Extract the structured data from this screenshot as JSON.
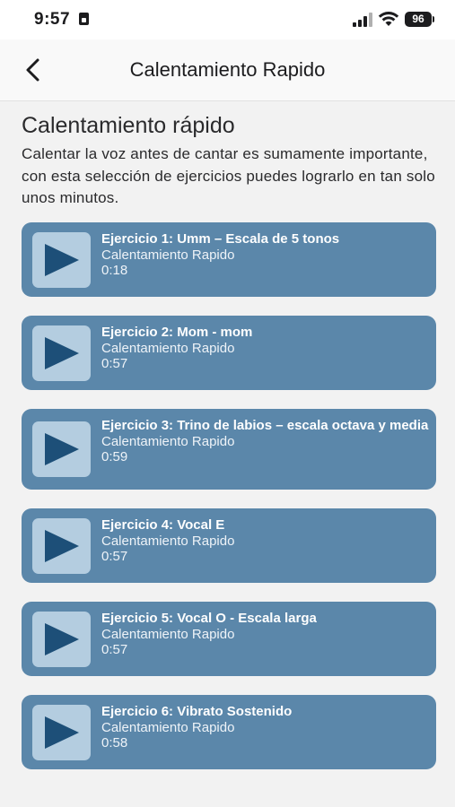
{
  "status_bar": {
    "time": "9:57",
    "battery": "96",
    "icons": [
      "sim-card-icon",
      "signal-bars-icon",
      "wifi-icon",
      "battery-icon"
    ]
  },
  "nav": {
    "back_icon": "chevron-left-icon",
    "title": "Calentamiento Rapido"
  },
  "header": {
    "title": "Calentamiento rápido",
    "description": "Calentar la voz antes de cantar es sumamente importante, con esta selección de ejercicios puedes lograrlo en tan solo unos minutos."
  },
  "colors": {
    "card_bg": "#5b87aa",
    "play_box_bg": "#b4cde0",
    "play_triangle": "#1d4f78",
    "page_bg": "#f2f2f2"
  },
  "exercises": [
    {
      "title": "Ejercicio 1: Umm – Escala de 5 tonos",
      "subtitle": "Calentamiento Rapido",
      "duration": "0:18",
      "icon": "play-icon"
    },
    {
      "title": "Ejercicio 2: Mom - mom",
      "subtitle": "Calentamiento Rapido",
      "duration": "0:57",
      "icon": "play-icon"
    },
    {
      "title": "Ejercicio 3: Trino de labios – escala octava y media",
      "subtitle": "Calentamiento Rapido",
      "duration": "0:59",
      "icon": "play-icon"
    },
    {
      "title": "Ejercicio 4: Vocal E",
      "subtitle": "Calentamiento Rapido",
      "duration": "0:57",
      "icon": "play-icon"
    },
    {
      "title": "Ejercicio 5: Vocal O - Escala larga",
      "subtitle": "Calentamiento Rapido",
      "duration": "0:57",
      "icon": "play-icon"
    },
    {
      "title": "Ejercicio 6: Vibrato Sostenido",
      "subtitle": "Calentamiento Rapido",
      "duration": "0:58",
      "icon": "play-icon"
    }
  ]
}
